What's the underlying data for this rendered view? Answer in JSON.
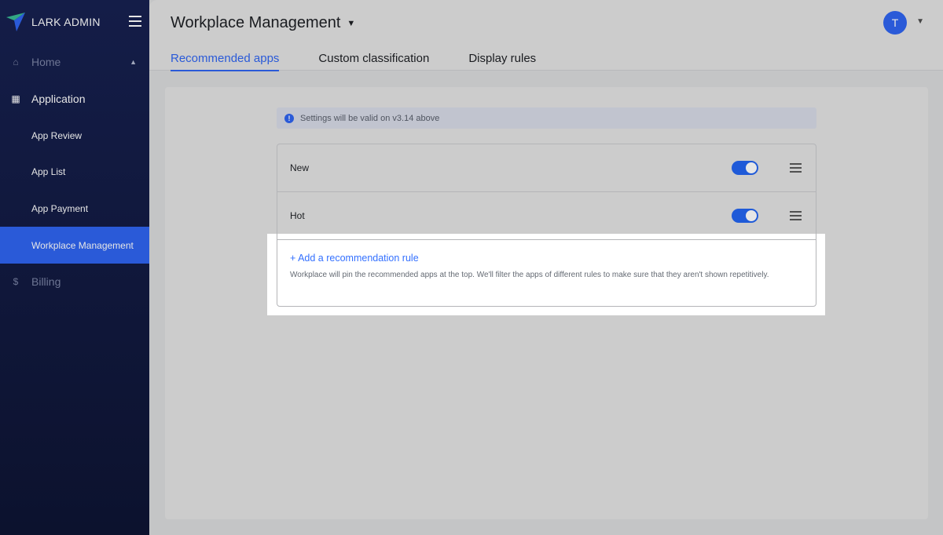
{
  "sidebar": {
    "brand": "LARK ADMIN",
    "items": [
      {
        "label": "Home",
        "icon": "home-icon"
      },
      {
        "label": "Application",
        "icon": "grid-icon"
      },
      {
        "label": "App Review"
      },
      {
        "label": "App List"
      },
      {
        "label": "App Payment"
      },
      {
        "label": "Workplace Management",
        "active": true
      },
      {
        "label": "Billing",
        "icon": "dollar-icon"
      }
    ]
  },
  "header": {
    "title": "Workplace Management",
    "avatar": "T",
    "tabs": [
      {
        "label": "Recommended apps",
        "active": true
      },
      {
        "label": "Custom classification"
      },
      {
        "label": "Display rules"
      }
    ]
  },
  "main": {
    "notice": "Settings will be valid on v3.14 above",
    "rules": [
      {
        "name": "New",
        "enabled": true
      },
      {
        "name": "Hot",
        "enabled": true
      }
    ],
    "add_rule": "+ Add a recommendation rule",
    "description": "Workplace will pin the recommended apps at the top. We'll filter the apps of different rules to make sure that they aren't shown repetitively."
  },
  "colors": {
    "accent": "#3370ff",
    "sidebar": "#19245a"
  }
}
